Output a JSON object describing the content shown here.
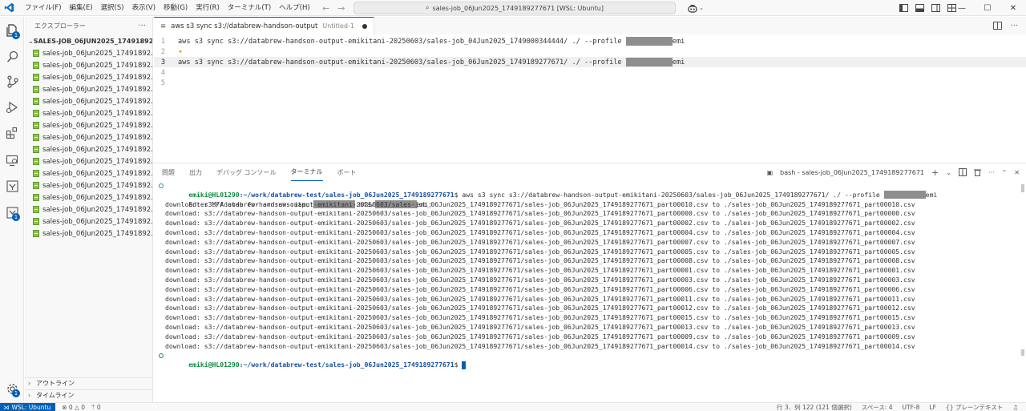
{
  "titlebar": {
    "menu": [
      "ファイル(F)",
      "編集(E)",
      "選択(S)",
      "表示(V)",
      "移動(G)",
      "実行(R)",
      "ターミナル(T)",
      "ヘルプ(H)"
    ],
    "command_center": "sales-job_06Jun2025_1749189277671 [WSL: Ubuntu]"
  },
  "sidebar": {
    "title": "エクスプローラー",
    "more": "···",
    "folder": "SALES-JOB_06JUN2025_17491892776...",
    "files": [
      "sales-job_06Jun2025_17491892...",
      "sales-job_06Jun2025_17491892...",
      "sales-job_06Jun2025_17491892...",
      "sales-job_06Jun2025_17491892...",
      "sales-job_06Jun2025_17491892...",
      "sales-job_06Jun2025_17491892...",
      "sales-job_06Jun2025_17491892...",
      "sales-job_06Jun2025_17491892...",
      "sales-job_06Jun2025_17491892...",
      "sales-job_06Jun2025_17491892...",
      "sales-job_06Jun2025_17491892...",
      "sales-job_06Jun2025_17491892...",
      "sales-job_06Jun2025_17491892...",
      "sales-job_06Jun2025_17491892...",
      "sales-job_06Jun2025_17491892...",
      "sales-job_06Jun2025_17491892..."
    ],
    "outline": "アウトライン",
    "timeline": "タイムライン"
  },
  "editor": {
    "tab_title": "aws s3 sync s3://databrew-handson-output",
    "tab_desc": "Untitled-1",
    "lines": [
      {
        "num": "1",
        "text": "aws s3 sync s3://databrew-handson-output-emikitani-20250603/sales-job_04Jun2025_1749000344444/ ./ --profile ",
        "suffix": "emi"
      },
      {
        "num": "2",
        "text": "",
        "suffix": ""
      },
      {
        "num": "3",
        "text": "aws s3 sync s3://databrew-handson-output-emikitani-20250603/sales-job_06Jun2025_1749189277671/ ./ --profile ",
        "suffix": "emi"
      },
      {
        "num": "4",
        "text": "",
        "suffix": ""
      },
      {
        "num": "5",
        "text": "",
        "suffix": ""
      }
    ]
  },
  "panel": {
    "tabs": [
      "問題",
      "出力",
      "デバッグ コンソール",
      "ターミナル",
      "ポート"
    ],
    "terminal_name": "bash - sales-job_06Jun2025_1749189277671",
    "prompt_user": "emiki@HL01290",
    "prompt_path": ":~/work/databrew-test/sales-job_06Jun2025_1749189277671",
    "command": "$ aws s3 sync s3://databrew-handson-output-emikitani-20250603/sales-job_06Jun2025_1749189277671/ ./ --profile ",
    "command_suffix": "emi",
    "mfa_prefix": "Enter MFA code for arn:aws:iam::",
    "mfa_middle": ":mfa/",
    "mfa_suffix": "emi:",
    "downloads": [
      "download: s3://databrew-handson-output-emikitani-20250603/sales-job_06Jun2025_1749189277671/sales-job_06Jun2025_1749189277671_part00010.csv to ./sales-job_06Jun2025_1749189277671_part00010.csv",
      "download: s3://databrew-handson-output-emikitani-20250603/sales-job_06Jun2025_1749189277671/sales-job_06Jun2025_1749189277671_part00000.csv to ./sales-job_06Jun2025_1749189277671_part00000.csv",
      "download: s3://databrew-handson-output-emikitani-20250603/sales-job_06Jun2025_1749189277671/sales-job_06Jun2025_1749189277671_part00002.csv to ./sales-job_06Jun2025_1749189277671_part00002.csv",
      "download: s3://databrew-handson-output-emikitani-20250603/sales-job_06Jun2025_1749189277671/sales-job_06Jun2025_1749189277671_part00004.csv to ./sales-job_06Jun2025_1749189277671_part00004.csv",
      "download: s3://databrew-handson-output-emikitani-20250603/sales-job_06Jun2025_1749189277671/sales-job_06Jun2025_1749189277671_part00007.csv to ./sales-job_06Jun2025_1749189277671_part00007.csv",
      "download: s3://databrew-handson-output-emikitani-20250603/sales-job_06Jun2025_1749189277671/sales-job_06Jun2025_1749189277671_part00005.csv to ./sales-job_06Jun2025_1749189277671_part00005.csv",
      "download: s3://databrew-handson-output-emikitani-20250603/sales-job_06Jun2025_1749189277671/sales-job_06Jun2025_1749189277671_part00008.csv to ./sales-job_06Jun2025_1749189277671_part00008.csv",
      "download: s3://databrew-handson-output-emikitani-20250603/sales-job_06Jun2025_1749189277671/sales-job_06Jun2025_1749189277671_part00001.csv to ./sales-job_06Jun2025_1749189277671_part00001.csv",
      "download: s3://databrew-handson-output-emikitani-20250603/sales-job_06Jun2025_1749189277671/sales-job_06Jun2025_1749189277671_part00003.csv to ./sales-job_06Jun2025_1749189277671_part00003.csv",
      "download: s3://databrew-handson-output-emikitani-20250603/sales-job_06Jun2025_1749189277671/sales-job_06Jun2025_1749189277671_part00006.csv to ./sales-job_06Jun2025_1749189277671_part00006.csv",
      "download: s3://databrew-handson-output-emikitani-20250603/sales-job_06Jun2025_1749189277671/sales-job_06Jun2025_1749189277671_part00011.csv to ./sales-job_06Jun2025_1749189277671_part00011.csv",
      "download: s3://databrew-handson-output-emikitani-20250603/sales-job_06Jun2025_1749189277671/sales-job_06Jun2025_1749189277671_part00012.csv to ./sales-job_06Jun2025_1749189277671_part00012.csv",
      "download: s3://databrew-handson-output-emikitani-20250603/sales-job_06Jun2025_1749189277671/sales-job_06Jun2025_1749189277671_part00015.csv to ./sales-job_06Jun2025_1749189277671_part00015.csv",
      "download: s3://databrew-handson-output-emikitani-20250603/sales-job_06Jun2025_1749189277671/sales-job_06Jun2025_1749189277671_part00013.csv to ./sales-job_06Jun2025_1749189277671_part00013.csv",
      "download: s3://databrew-handson-output-emikitani-20250603/sales-job_06Jun2025_1749189277671/sales-job_06Jun2025_1749189277671_part00009.csv to ./sales-job_06Jun2025_1749189277671_part00009.csv",
      "download: s3://databrew-handson-output-emikitani-20250603/sales-job_06Jun2025_1749189277671/sales-job_06Jun2025_1749189277671_part00014.csv to ./sales-job_06Jun2025_1749189277671_part00014.csv"
    ],
    "final_prompt_suffix": "$ "
  },
  "statusbar": {
    "remote": "WSL: Ubuntu",
    "errors": "0",
    "warnings": "0",
    "ports": "0",
    "position": "行 3、列 122 (121 個選択)",
    "spaces": "スペース: 4",
    "encoding": "UTF-8",
    "eol": "LF",
    "language": "プレーンテキスト"
  },
  "colors": {
    "accent": "#005fb8",
    "prompt_green": "#0b8a3e",
    "path_blue": "#1a4fa3",
    "file_icon": "#8bc34a"
  }
}
